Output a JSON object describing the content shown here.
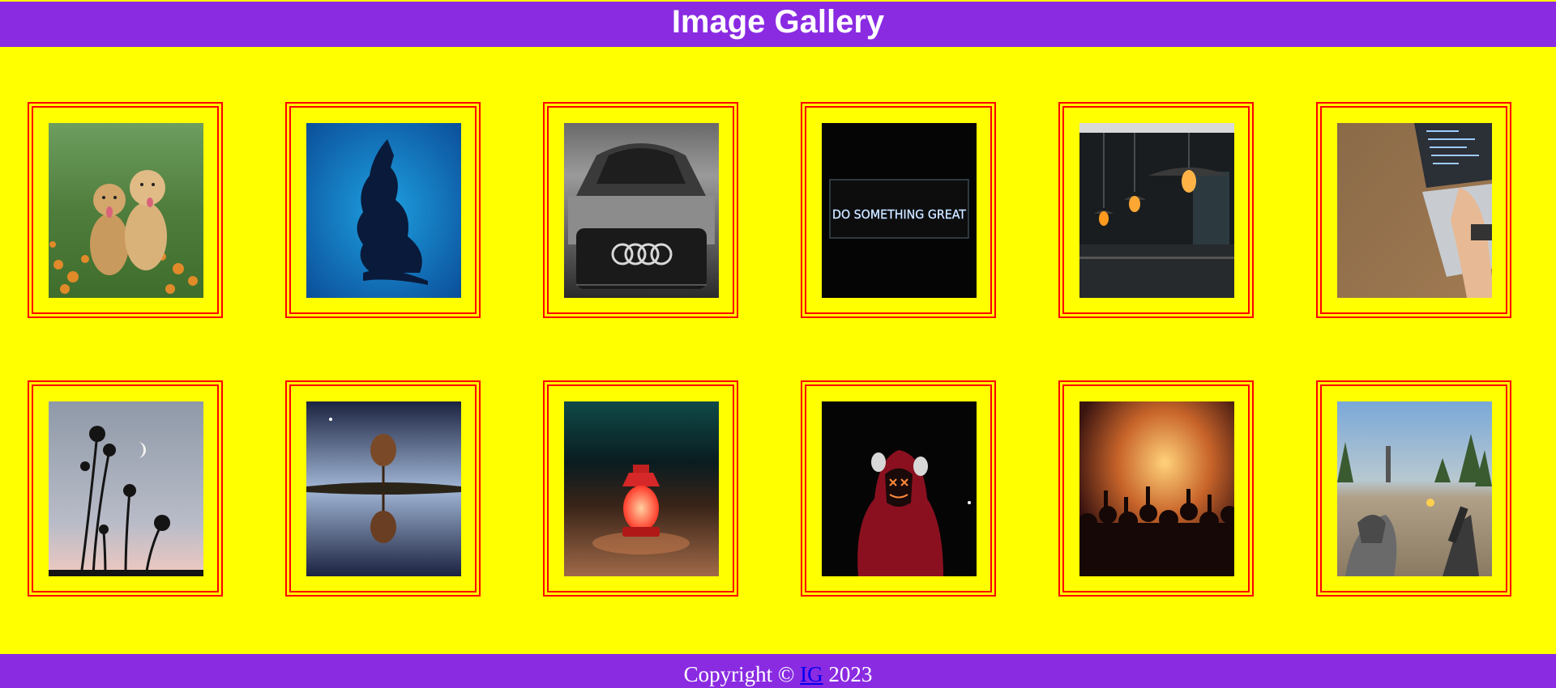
{
  "header": {
    "title": "Image Gallery"
  },
  "colors": {
    "page_background": "#ffff00",
    "bar_background": "#8a2be2",
    "frame_border": "#ff0000",
    "link": "#0000ee"
  },
  "gallery": {
    "images": [
      {
        "icon": "puppies-image"
      },
      {
        "icon": "shiva-silhouette-image"
      },
      {
        "icon": "audi-car-image"
      },
      {
        "icon": "neon-sign-image",
        "sign_text": "DO SOMETHING GREAT"
      },
      {
        "icon": "pendant-lamps-image"
      },
      {
        "icon": "laptop-typing-image"
      },
      {
        "icon": "moon-trees-image"
      },
      {
        "icon": "tree-reflection-image"
      },
      {
        "icon": "lantern-image"
      },
      {
        "icon": "hooded-mask-image"
      },
      {
        "icon": "concert-crowd-image"
      },
      {
        "icon": "game-scene-image"
      }
    ]
  },
  "footer": {
    "prefix": "Copyright ©",
    "link_text": "IG",
    "year": "2023"
  }
}
